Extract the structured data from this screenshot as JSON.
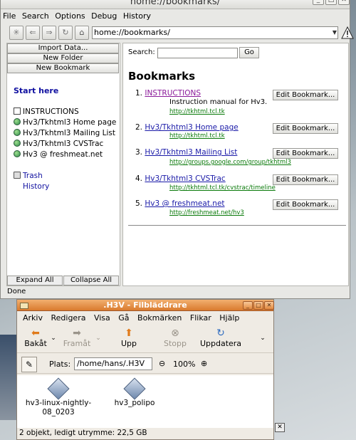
{
  "hv3": {
    "title": "home://bookmarks/",
    "window_controls": [
      "×",
      "□",
      "✕"
    ],
    "menus": [
      "File",
      "Search",
      "Options",
      "Debug",
      "History"
    ],
    "url": "home://bookmarks/",
    "sidebar": {
      "buttons": [
        "Import Data...",
        "New Folder",
        "New Bookmark"
      ],
      "start": "Start here",
      "items": [
        {
          "label": "INSTRUCTIONS",
          "icon": "document-icon"
        },
        {
          "label": "Hv3/Tkhtml3 Home page",
          "icon": "globe-icon"
        },
        {
          "label": "Hv3/Tkhtml3 Mailing List",
          "icon": "globe-icon"
        },
        {
          "label": "Hv3/Tkhtml3 CVSTrac",
          "icon": "globe-icon"
        },
        {
          "label": "Hv3 @ freshmeat.net",
          "icon": "globe-icon"
        }
      ],
      "trash": "Trash",
      "history": "History",
      "expand_all": "Expand All",
      "collapse_all": "Collapse All"
    },
    "content": {
      "search_label": "Search:",
      "search_value": "",
      "go_label": "Go",
      "heading": "Bookmarks",
      "edit_label": "Edit Bookmark...",
      "bookmarks": [
        {
          "num": "1.",
          "title": "INSTRUCTIONS",
          "desc": "Instruction manual for Hv3.",
          "url": "http://tkhtml.tcl.tk"
        },
        {
          "num": "2.",
          "title": "Hv3/Tkhtml3 Home page",
          "desc": "",
          "url": "http://tkhtml.tcl.tk"
        },
        {
          "num": "3.",
          "title": "Hv3/Tkhtml3 Mailing List",
          "desc": "",
          "url": "http://groups.google.com/group/tkhtml3"
        },
        {
          "num": "4.",
          "title": "Hv3/Tkhtml3 CVSTrac",
          "desc": "",
          "url": "http://tkhtml.tcl.tk/cvstrac/timeline"
        },
        {
          "num": "5.",
          "title": "Hv3 @ freshmeat.net",
          "desc": "",
          "url": "http://freshmeat.net/hv3"
        }
      ]
    },
    "status": "Done"
  },
  "nautilus": {
    "title": ".H3V - Filbläddrare",
    "menus": [
      "Arkiv",
      "Redigera",
      "Visa",
      "Gå",
      "Bokmärken",
      "Flikar",
      "Hjälp"
    ],
    "toolbar": {
      "back": "Bakåt",
      "forward": "Framåt",
      "up": "Upp",
      "stop": "Stopp",
      "reload": "Uppdatera"
    },
    "location_label": "Plats:",
    "location": "/home/hans/.H3V",
    "zoom": "100%",
    "files": [
      "hv3-linux-nightly-08_0203",
      "hv3_polipo"
    ],
    "status": "2 objekt, ledigt utrymme: 22,5 GB"
  },
  "colors": {
    "link": "#1a1aa8",
    "visited_link": "#8a1a9a",
    "url_green": "#0a7a0a",
    "nautilus_titlebar": "#d97a2e"
  }
}
